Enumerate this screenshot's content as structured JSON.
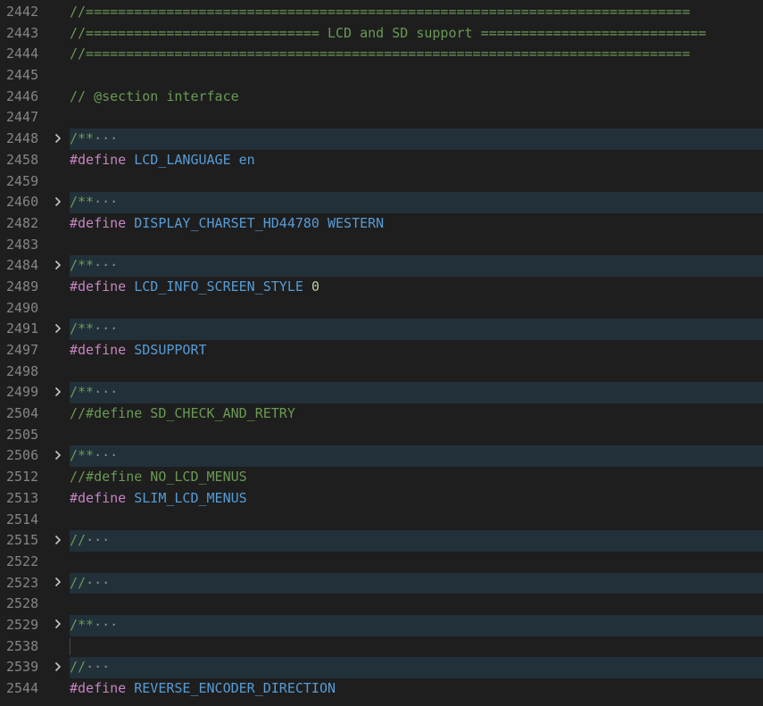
{
  "editor": {
    "lines": [
      {
        "number": "2442",
        "code": "//==========================================================================="
      },
      {
        "number": "2443",
        "code": "//============================= LCD and SD support ============================"
      },
      {
        "number": "2444",
        "code": "//==========================================================================="
      },
      {
        "number": "2445",
        "code": ""
      },
      {
        "number": "2446",
        "code": "// @section interface"
      },
      {
        "number": "2447",
        "code": ""
      },
      {
        "number": "2448",
        "code": "/**",
        "ellipsis": "···"
      },
      {
        "number": "2458",
        "kw": "#define",
        "macro": "LCD_LANGUAGE",
        "value": "en"
      },
      {
        "number": "2459",
        "code": ""
      },
      {
        "number": "2460",
        "code": "/**",
        "ellipsis": "···"
      },
      {
        "number": "2482",
        "kw": "#define",
        "macro": "DISPLAY_CHARSET_HD44780",
        "value": "WESTERN"
      },
      {
        "number": "2483",
        "code": ""
      },
      {
        "number": "2484",
        "code": "/**",
        "ellipsis": "···"
      },
      {
        "number": "2489",
        "kw": "#define",
        "macro": "LCD_INFO_SCREEN_STYLE",
        "value": "0"
      },
      {
        "number": "2490",
        "code": ""
      },
      {
        "number": "2491",
        "code": "/**",
        "ellipsis": "···"
      },
      {
        "number": "2497",
        "kw": "#define",
        "macro": "SDSUPPORT"
      },
      {
        "number": "2498",
        "code": ""
      },
      {
        "number": "2499",
        "code": "/**",
        "ellipsis": "···"
      },
      {
        "number": "2504",
        "code": "//#define SD_CHECK_AND_RETRY"
      },
      {
        "number": "2505",
        "code": ""
      },
      {
        "number": "2506",
        "code": "/**",
        "ellipsis": "···"
      },
      {
        "number": "2512",
        "code": "//#define NO_LCD_MENUS"
      },
      {
        "number": "2513",
        "kw": "#define",
        "macro": "SLIM_LCD_MENUS"
      },
      {
        "number": "2514",
        "code": ""
      },
      {
        "number": "2515",
        "code": "//",
        "ellipsis": "···"
      },
      {
        "number": "2522",
        "code": ""
      },
      {
        "number": "2523",
        "code": "//",
        "ellipsis": "···"
      },
      {
        "number": "2528",
        "code": ""
      },
      {
        "number": "2529",
        "code": "/**",
        "ellipsis": "···"
      },
      {
        "number": "2538",
        "code": ""
      },
      {
        "number": "2539",
        "code": "//",
        "ellipsis": "···"
      },
      {
        "number": "2544",
        "kw": "#define",
        "macro": "REVERSE_ENCODER_DIRECTION"
      }
    ]
  },
  "icons": {
    "fold": "chevron-right-icon"
  },
  "colors": {
    "background": "#1e1e1e",
    "folded_highlight": "#223039",
    "line_number": "#858585",
    "comment": "#6a9955",
    "keyword": "#c586c0",
    "macro": "#569cd6",
    "number": "#b5cea8"
  }
}
